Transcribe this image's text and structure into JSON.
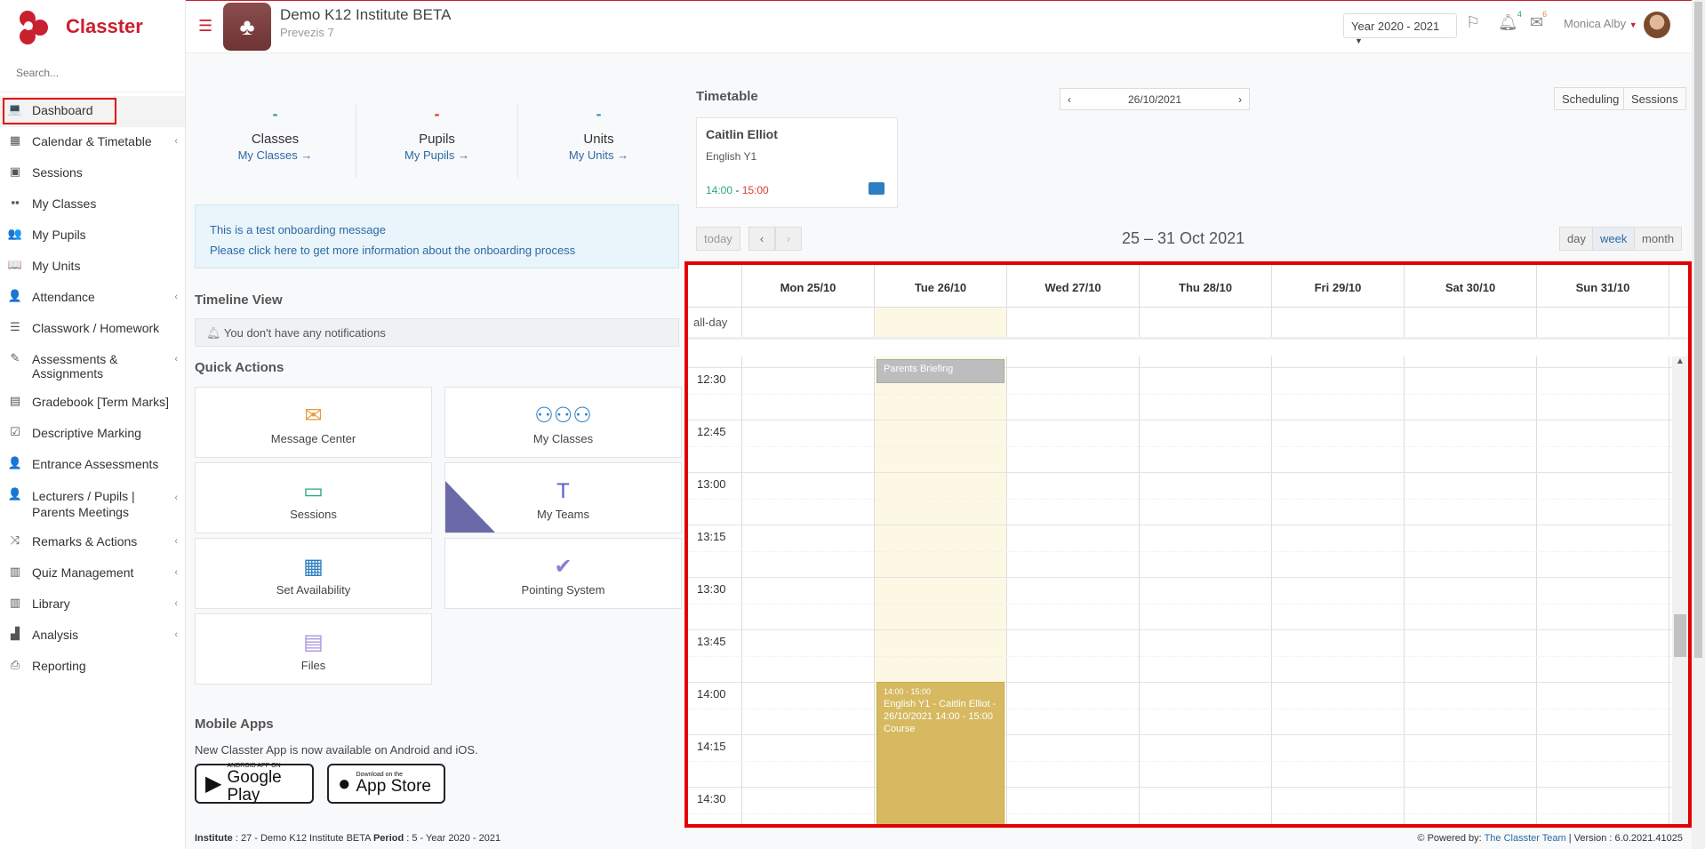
{
  "brand": {
    "name": "Classter"
  },
  "sidebar": {
    "search_placeholder": "Search...",
    "items": [
      {
        "label": "Dashboard",
        "icon": "laptop-icon",
        "glyph": "💻",
        "chevron": false
      },
      {
        "label": "Calendar & Timetable",
        "icon": "calendar-icon",
        "glyph": "▦",
        "chevron": true
      },
      {
        "label": "Sessions",
        "icon": "sessions-icon",
        "glyph": "▣",
        "chevron": false
      },
      {
        "label": "My Classes",
        "icon": "classes-icon",
        "glyph": "▪▪",
        "chevron": false
      },
      {
        "label": "My Pupils",
        "icon": "pupils-icon",
        "glyph": "👥",
        "chevron": false
      },
      {
        "label": "My Units",
        "icon": "book-icon",
        "glyph": "📖",
        "chevron": false
      },
      {
        "label": "Attendance",
        "icon": "attendance-icon",
        "glyph": "👤",
        "chevron": true
      },
      {
        "label": "Classwork / Homework",
        "icon": "list-icon",
        "glyph": "☰",
        "chevron": false
      },
      {
        "label": "Assessments & Assignments",
        "icon": "edit-icon",
        "glyph": "✎",
        "chevron": true
      },
      {
        "label": "Gradebook [Term Marks]",
        "icon": "gradebook-icon",
        "glyph": "▤",
        "chevron": false
      },
      {
        "label": "Descriptive Marking",
        "icon": "check-icon",
        "glyph": "☑",
        "chevron": false
      },
      {
        "label": "Entrance Assessments",
        "icon": "user-gear-icon",
        "glyph": "👤",
        "chevron": false
      },
      {
        "label": "Lecturers / Pupils | Parents Meetings",
        "icon": "meeting-icon",
        "glyph": "👤",
        "chevron": true
      },
      {
        "label": "Remarks & Actions",
        "icon": "shuffle-icon",
        "glyph": "⤨",
        "chevron": true
      },
      {
        "label": "Quiz Management",
        "icon": "quiz-icon",
        "glyph": "▥",
        "chevron": true
      },
      {
        "label": "Library",
        "icon": "library-icon",
        "glyph": "▥",
        "chevron": true
      },
      {
        "label": "Analysis",
        "icon": "chart-icon",
        "glyph": "▟",
        "chevron": true
      },
      {
        "label": "Reporting",
        "icon": "print-icon",
        "glyph": "⎙",
        "chevron": false
      }
    ]
  },
  "header": {
    "institute_name": "Demo K12 Institute BETA",
    "institute_sub": "Prevezis 7",
    "year_select": "Year 2020 - 2021",
    "notifications_count": "4",
    "messages_count": "6",
    "user_name": "Monica Alby"
  },
  "stats": [
    {
      "value": "-",
      "label": "Classes",
      "link": "My Classes →",
      "color": "#2aa87a"
    },
    {
      "value": "-",
      "label": "Pupils",
      "link": "My Pupils →",
      "color": "#e03c31"
    },
    {
      "value": "-",
      "label": "Units",
      "link": "My Units →",
      "color": "#2d9fb3"
    }
  ],
  "onboarding": {
    "line1": "This is a test onboarding message",
    "line2": "Please click here to get more information about the onboarding process"
  },
  "timeline": {
    "title": "Timeline View",
    "empty": "You don't have any notifications"
  },
  "quick_actions": {
    "title": "Quick Actions",
    "items": [
      {
        "label": "Message Center",
        "icon": "envelope-icon"
      },
      {
        "label": "My Classes",
        "icon": "group-icon"
      },
      {
        "label": "Sessions",
        "icon": "presentation-icon"
      },
      {
        "label": "My Teams",
        "icon": "teams-icon"
      },
      {
        "label": "Set Availability",
        "icon": "calendar-icon"
      },
      {
        "label": "Pointing System",
        "icon": "badge-check-icon"
      },
      {
        "label": "Files",
        "icon": "archive-icon"
      }
    ]
  },
  "mobile": {
    "title": "Mobile Apps",
    "text": "New Classter App is now available on Android and iOS.",
    "google_small": "ANDROID APP ON",
    "google_big": "Google Play",
    "apple_small": "Download on the",
    "apple_big": "App Store"
  },
  "footer": {
    "left_label1": "Institute",
    "left_value1": ": 27 - Demo K12 Institute BETA",
    "left_label2": "Period",
    "left_value2": ": 5 - Year 2020 - 2021",
    "powered_by": "Powered by:",
    "powered_link": "The Classter Team",
    "version": "| Version : 6.0.2021.41025"
  },
  "timetable": {
    "title": "Timetable",
    "date": "26/10/2021",
    "scheduling": "Scheduling",
    "sessions": "Sessions",
    "card": {
      "name": "Caitlin Elliot",
      "course": "English Y1",
      "start": "14:00",
      "sep": " - ",
      "end": "15:00"
    }
  },
  "calendar": {
    "today": "today",
    "prev": "‹",
    "next": "›",
    "range": "25 – 31 Oct 2021",
    "views": [
      "day",
      "week",
      "month"
    ],
    "active_view": "week",
    "allday_label": "all-day",
    "days": [
      "Mon 25/10",
      "Tue 26/10",
      "Wed 27/10",
      "Thu 28/10",
      "Fri 29/10",
      "Sat 30/10",
      "Sun 31/10"
    ],
    "today_index": 1,
    "slots": [
      "12:30",
      "12:45",
      "13:00",
      "13:15",
      "13:30",
      "13:45",
      "14:00",
      "14:15",
      "14:30"
    ],
    "events": [
      {
        "day": 1,
        "start_slot": -0.15,
        "end_slot": 0.3,
        "title": "Parents Briefing",
        "color": "grey"
      },
      {
        "day": 1,
        "start_slot": 6.0,
        "end_slot": 10.0,
        "time": "14:00 - 15:00",
        "title": "English Y1 - Caitlin Elliot - 26/10/2021 14:00 - 15:00 Course",
        "color": "gold"
      }
    ]
  },
  "colors": {
    "brand": "#c8202f",
    "link": "#2d6aa3",
    "highlight": "#e40000"
  }
}
